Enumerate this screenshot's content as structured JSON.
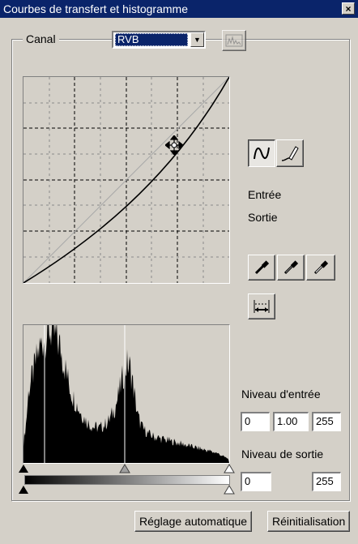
{
  "window": {
    "title": "Courbes de transfert et histogramme",
    "close_glyph": "×"
  },
  "channel": {
    "label": "Canal",
    "value": "RVB"
  },
  "curve_tools": {
    "curve_icon": "smooth-curve-icon",
    "pencil_icon": "freehand-pencil-icon"
  },
  "readout": {
    "input_label": "Entrée",
    "output_label": "Sortie"
  },
  "eyedroppers": [
    "black-point-eyedropper-icon",
    "gray-point-eyedropper-icon",
    "white-point-eyedropper-icon"
  ],
  "input_level": {
    "label": "Niveau d'entrée",
    "black": "0",
    "gamma": "1.00",
    "white": "255"
  },
  "output_level": {
    "label": "Niveau de sortie",
    "black": "0",
    "white": "255"
  },
  "buttons": {
    "auto": "Réglage automatique",
    "reset": "Réinitialisation"
  },
  "histogram_shape": [
    0.15,
    0.3,
    0.55,
    0.62,
    0.7,
    0.78,
    0.85,
    0.9,
    0.94,
    0.97,
    1.0,
    0.98,
    0.96,
    0.92,
    0.88,
    0.8,
    0.72,
    0.64,
    0.56,
    0.5,
    0.46,
    0.42,
    0.38,
    0.35,
    0.32,
    0.3,
    0.28,
    0.27,
    0.27,
    0.26,
    0.27,
    0.28,
    0.3,
    0.32,
    0.36,
    0.4,
    0.46,
    0.54,
    0.62,
    0.7,
    0.74,
    0.72,
    0.62,
    0.48,
    0.36,
    0.3,
    0.26,
    0.24,
    0.22,
    0.21,
    0.2,
    0.19,
    0.19,
    0.18,
    0.18,
    0.17,
    0.17,
    0.16,
    0.16,
    0.15,
    0.15,
    0.14,
    0.14,
    0.13,
    0.13,
    0.12,
    0.12,
    0.11,
    0.11,
    0.1,
    0.1,
    0.09,
    0.09,
    0.08,
    0.08,
    0.07,
    0.06,
    0.05,
    0.04,
    0.03
  ]
}
